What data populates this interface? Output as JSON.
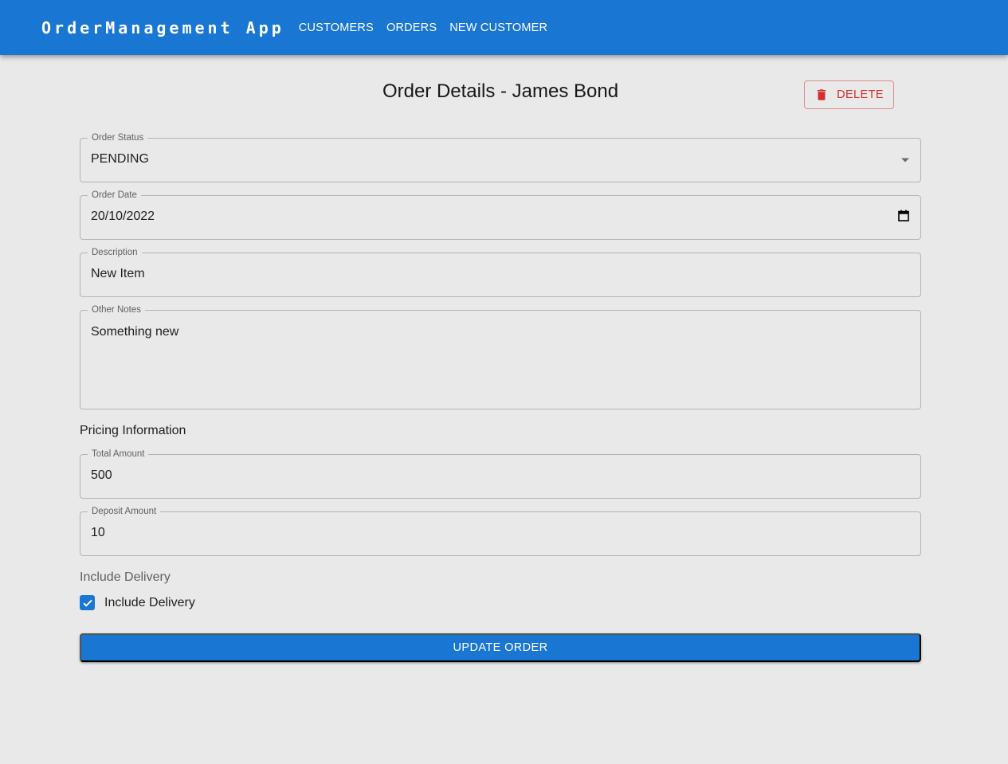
{
  "appbar": {
    "brand": "OrderManagement App",
    "nav": [
      {
        "label": "CUSTOMERS"
      },
      {
        "label": "ORDERS"
      },
      {
        "label": "NEW CUSTOMER"
      }
    ]
  },
  "page": {
    "title": "Order Details - James Bond",
    "delete_label": "DELETE"
  },
  "form": {
    "order_status": {
      "label": "Order Status",
      "value": "PENDING"
    },
    "order_date": {
      "label": "Order Date",
      "value": "20/10/2022"
    },
    "description": {
      "label": "Description",
      "value": "New Item"
    },
    "other_notes": {
      "label": "Other Notes",
      "value": "Something new"
    },
    "pricing_title": "Pricing Information",
    "total_amount": {
      "label": "Total Amount",
      "value": "500"
    },
    "deposit_amount": {
      "label": "Deposit Amount",
      "value": "10"
    },
    "delivery_group_label": "Include Delivery",
    "include_delivery": {
      "label": "Include Delivery",
      "checked": true
    },
    "submit_label": "UPDATE ORDER"
  },
  "colors": {
    "primary": "#1976d2",
    "danger": "#d32f2f",
    "background": "#e9e9e9"
  }
}
